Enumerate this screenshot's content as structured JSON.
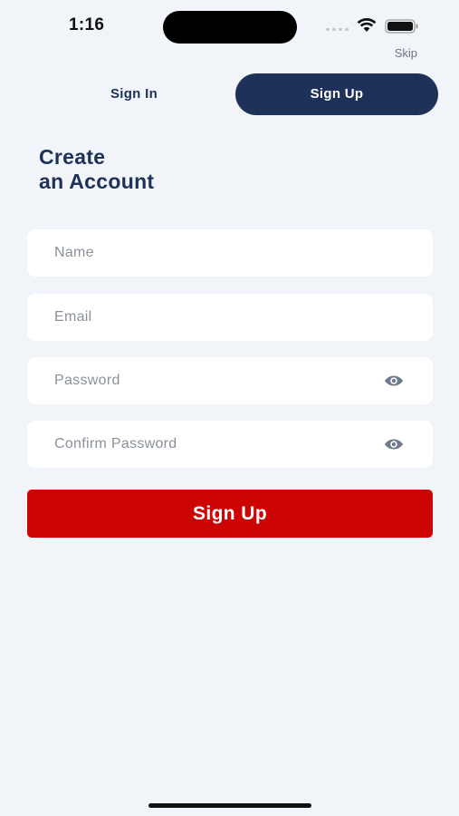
{
  "status_bar": {
    "time": "1:16"
  },
  "header": {
    "skip_label": "Skip"
  },
  "tabs": [
    {
      "label": "Sign In",
      "active": false
    },
    {
      "label": "Sign Up",
      "active": true
    }
  ],
  "title": {
    "line1": "Create",
    "line2": "an Account"
  },
  "form": {
    "name": {
      "placeholder": "Name",
      "value": ""
    },
    "email": {
      "placeholder": "Email",
      "value": ""
    },
    "password": {
      "placeholder": "Password",
      "value": "",
      "icon": "eye-icon"
    },
    "confirm_password": {
      "placeholder": "Confirm Password",
      "value": "",
      "icon": "eye-icon"
    },
    "submit_label": "Sign Up"
  },
  "colors": {
    "background": "#f1f4f8",
    "navy": "#1e3159",
    "accent_red": "#cc0404",
    "field_bg": "#ffffff",
    "placeholder": "#8a919c"
  }
}
